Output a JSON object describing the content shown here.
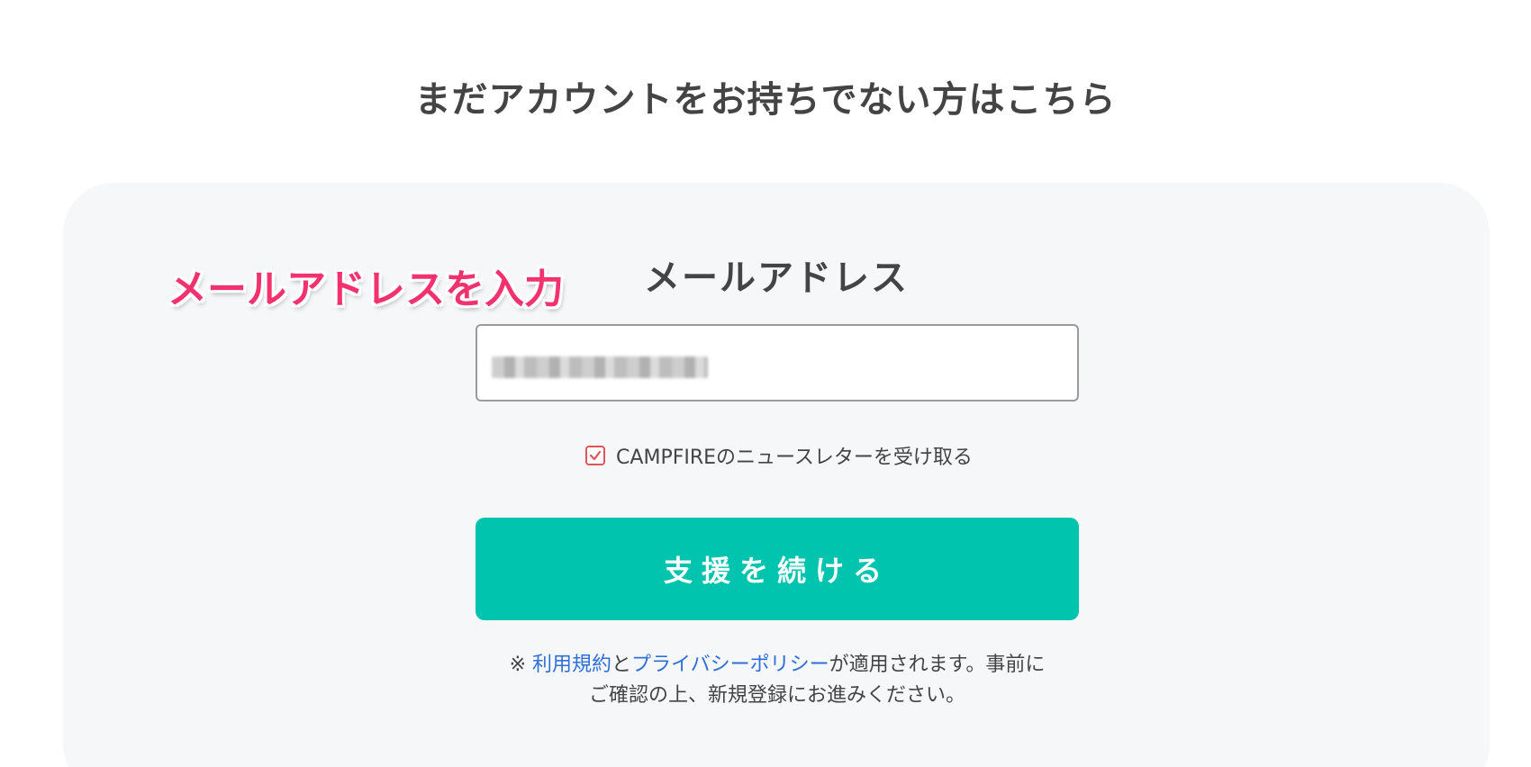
{
  "heading": "まだアカウントをお持ちでない方はこちら",
  "annotation": "メールアドレスを入力",
  "form": {
    "email_label": "メールアドレス",
    "email_value": "",
    "newsletter_checked": true,
    "newsletter_label": "CAMPFIREのニュースレターを受け取る",
    "submit_label": "支援を続ける"
  },
  "terms": {
    "prefix": "※ ",
    "terms_link": "利用規約",
    "connector": "と",
    "privacy_link": "プライバシーポリシー",
    "line1_suffix": "が適用されます。事前に",
    "line2": "ご確認の上、新規登録にお進みください。"
  },
  "colors": {
    "accent": "#00c4ae",
    "annotation": "#f2326f",
    "link": "#2f6fd8",
    "checkbox": "#e0545a",
    "card_bg": "#f6f7f9"
  },
  "icons": {
    "checkbox": "checkmark-icon"
  }
}
